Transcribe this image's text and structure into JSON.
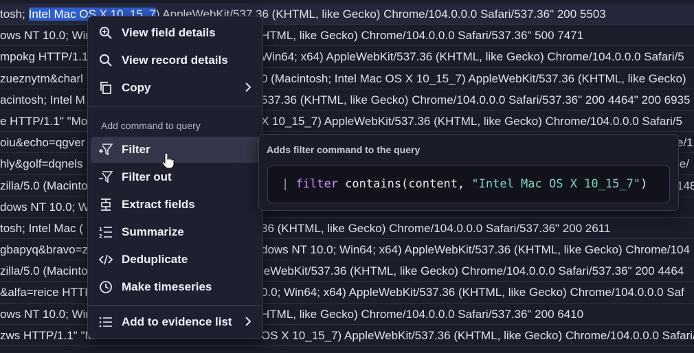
{
  "log_rows": [
    {
      "pre": "tosh; ",
      "hl": "Intel Mac OS X 10_15_7",
      "post": ") AppleWebKit/537.36 (KHTML, like Gecko) Chrome/104.0.0.0 Safari/537.36\" 200 5503",
      "right": ""
    },
    {
      "pre": "ows NT 10.0; Win",
      "hl": "",
      "post": "",
      "right": "HTML, like Gecko) Chrome/104.0.0.0 Safari/537.36\" 500 7471"
    },
    {
      "pre": "mpokg HTTP/1.1",
      "hl": "",
      "post": "",
      "right": "Win64; x64) AppleWebKit/537.36 (KHTML, like Gecko) Chrome/104.0.0.0 Safari/5"
    },
    {
      "pre": "zueznytm&charl",
      "hl": "",
      "post": "",
      "right": "0 (Macintosh; Intel Mac OS X 10_15_7) AppleWebKit/537.36 (KHTML, like Gecko)"
    },
    {
      "pre": "acintosh; Intel M",
      "hl": "",
      "post": "",
      "right": "537.36 (KHTML, like Gecko) Chrome/104.0.0.0 Safari/537.36\" 200 4464\" 200 6935"
    },
    {
      "pre": "e HTTP/1.1\" \"Moz",
      "hl": "",
      "post": "",
      "right": "X 10_15_7) AppleWebKit/537.36 (KHTML, like Gecko) Chrome/104.0.0.0 Safari/5"
    },
    {
      "pre": "oiu&echo=qgver",
      "hl": "",
      "post": "",
      "right": "e/1"
    },
    {
      "pre": "hly&golf=dqnels",
      "hl": "",
      "post": "",
      "right": "le/"
    },
    {
      "pre": "zilla/5.0 (Macinto",
      "hl": "",
      "post": "",
      "right": "148"
    },
    {
      "pre": "dows NT 10.0; Wi",
      "hl": "",
      "post": "",
      "right": ""
    },
    {
      "pre": "tosh; Intel Mac (",
      "hl": "",
      "post": "",
      "right": "36 (KHTML, like Gecko) Chrome/104.0.0.0 Safari/537.36\" 200 2611"
    },
    {
      "pre": "gbapyq&bravo=z",
      "hl": "",
      "post": "",
      "right": "dows NT 10.0; Win64; x64) AppleWebKit/537.36 (KHTML, like Gecko) Chrome/104"
    },
    {
      "pre": "zilla/5.0 (Macinto",
      "hl": "",
      "post": "",
      "right": "leWebKit/537.36 (KHTML, like Gecko) Chrome/104.0.0.0 Safari/537.36\" 200 4464"
    },
    {
      "pre": "&alfa=reice HTTF",
      "hl": "",
      "post": "",
      "right": "0.0; Win64; x64) AppleWebKit/537.36 (KHTML, like Gecko) Chrome/104.0.0.0 Saf"
    },
    {
      "pre": "ows NT 10.0; Win",
      "hl": "",
      "post": "",
      "right": "HTML, like Gecko) Chrome/104.0.0.0 Safari/537.36\" 200 6410"
    },
    {
      "pre": "zws HTTP/1.1\" \"M",
      "hl": "",
      "post": "",
      "right": "OS X 10_15_7) AppleWebKit/537.36 (KHTML, like Gecko) Chrome/104.0.0.0 Safari/5"
    }
  ],
  "menu": {
    "view_field_details": "View field details",
    "view_record_details": "View record details",
    "copy": "Copy",
    "section_label": "Add command to query",
    "filter": "Filter",
    "filter_out": "Filter out",
    "extract_fields": "Extract fields",
    "summarize": "Summarize",
    "deduplicate": "Deduplicate",
    "make_timeseries": "Make timeseries",
    "add_to_evidence_list": "Add to evidence list"
  },
  "tooltip": {
    "title": "Adds filter command to the query",
    "code_pipe": "|",
    "code_keyword": "filter",
    "code_fn": "contains(content, ",
    "code_string": "\"Intel Mac OS X 10_15_7\"",
    "code_close": ")"
  },
  "colors": {
    "background": "#1b1d2b",
    "selection": "#2f5fcf",
    "menu_bg": "#1e2030",
    "keyword": "#c593ff",
    "string": "#7fd3c8"
  }
}
